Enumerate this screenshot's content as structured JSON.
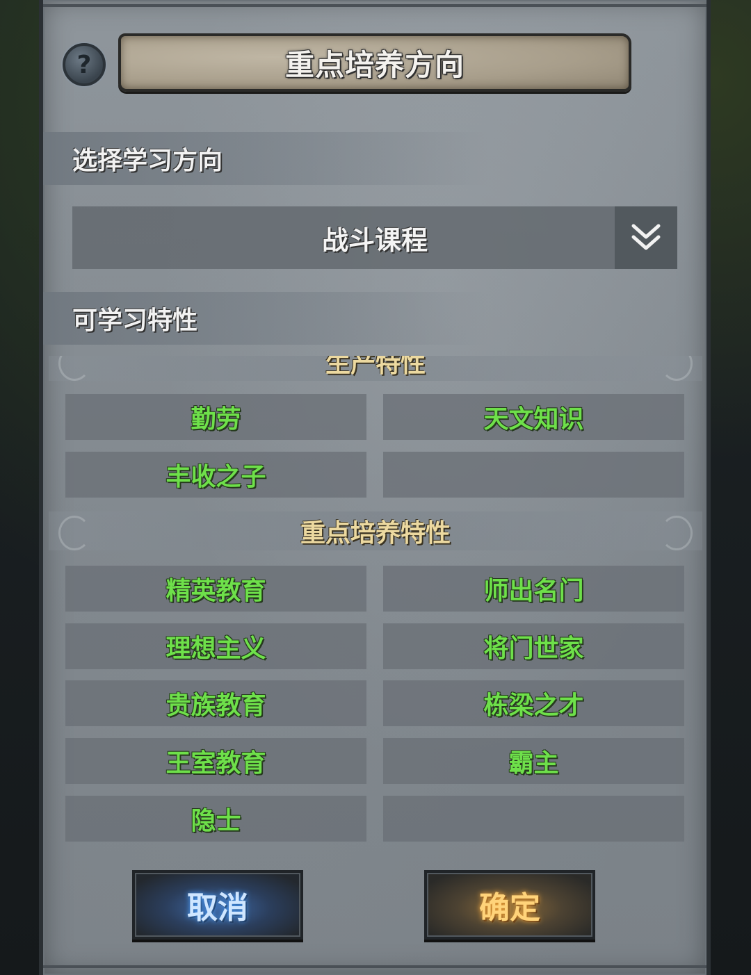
{
  "dialog": {
    "title": "重点培养方向",
    "help_icon": "question-mark-icon"
  },
  "direction_section": {
    "label": "选择学习方向",
    "dropdown": {
      "selected": "战斗课程",
      "icon": "double-chevron-down-icon"
    }
  },
  "traits_section": {
    "label": "可学习特性",
    "groups": [
      {
        "header": "生产特性",
        "items": [
          "勤劳",
          "天文知识",
          "丰收之子",
          ""
        ]
      },
      {
        "header": "重点培养特性",
        "items": [
          "精英教育",
          "师出名门",
          "理想主义",
          "将门世家",
          "贵族教育",
          "栋梁之才",
          "王室教育",
          "霸主",
          "隐士",
          ""
        ]
      }
    ]
  },
  "actions": {
    "cancel_label": "取消",
    "confirm_label": "确定"
  },
  "colors": {
    "trait_text": "#6ee04a",
    "group_header_text": "#ecd9a0",
    "cancel_glow": "#4aa0ff",
    "confirm_glow": "#ffb040"
  }
}
